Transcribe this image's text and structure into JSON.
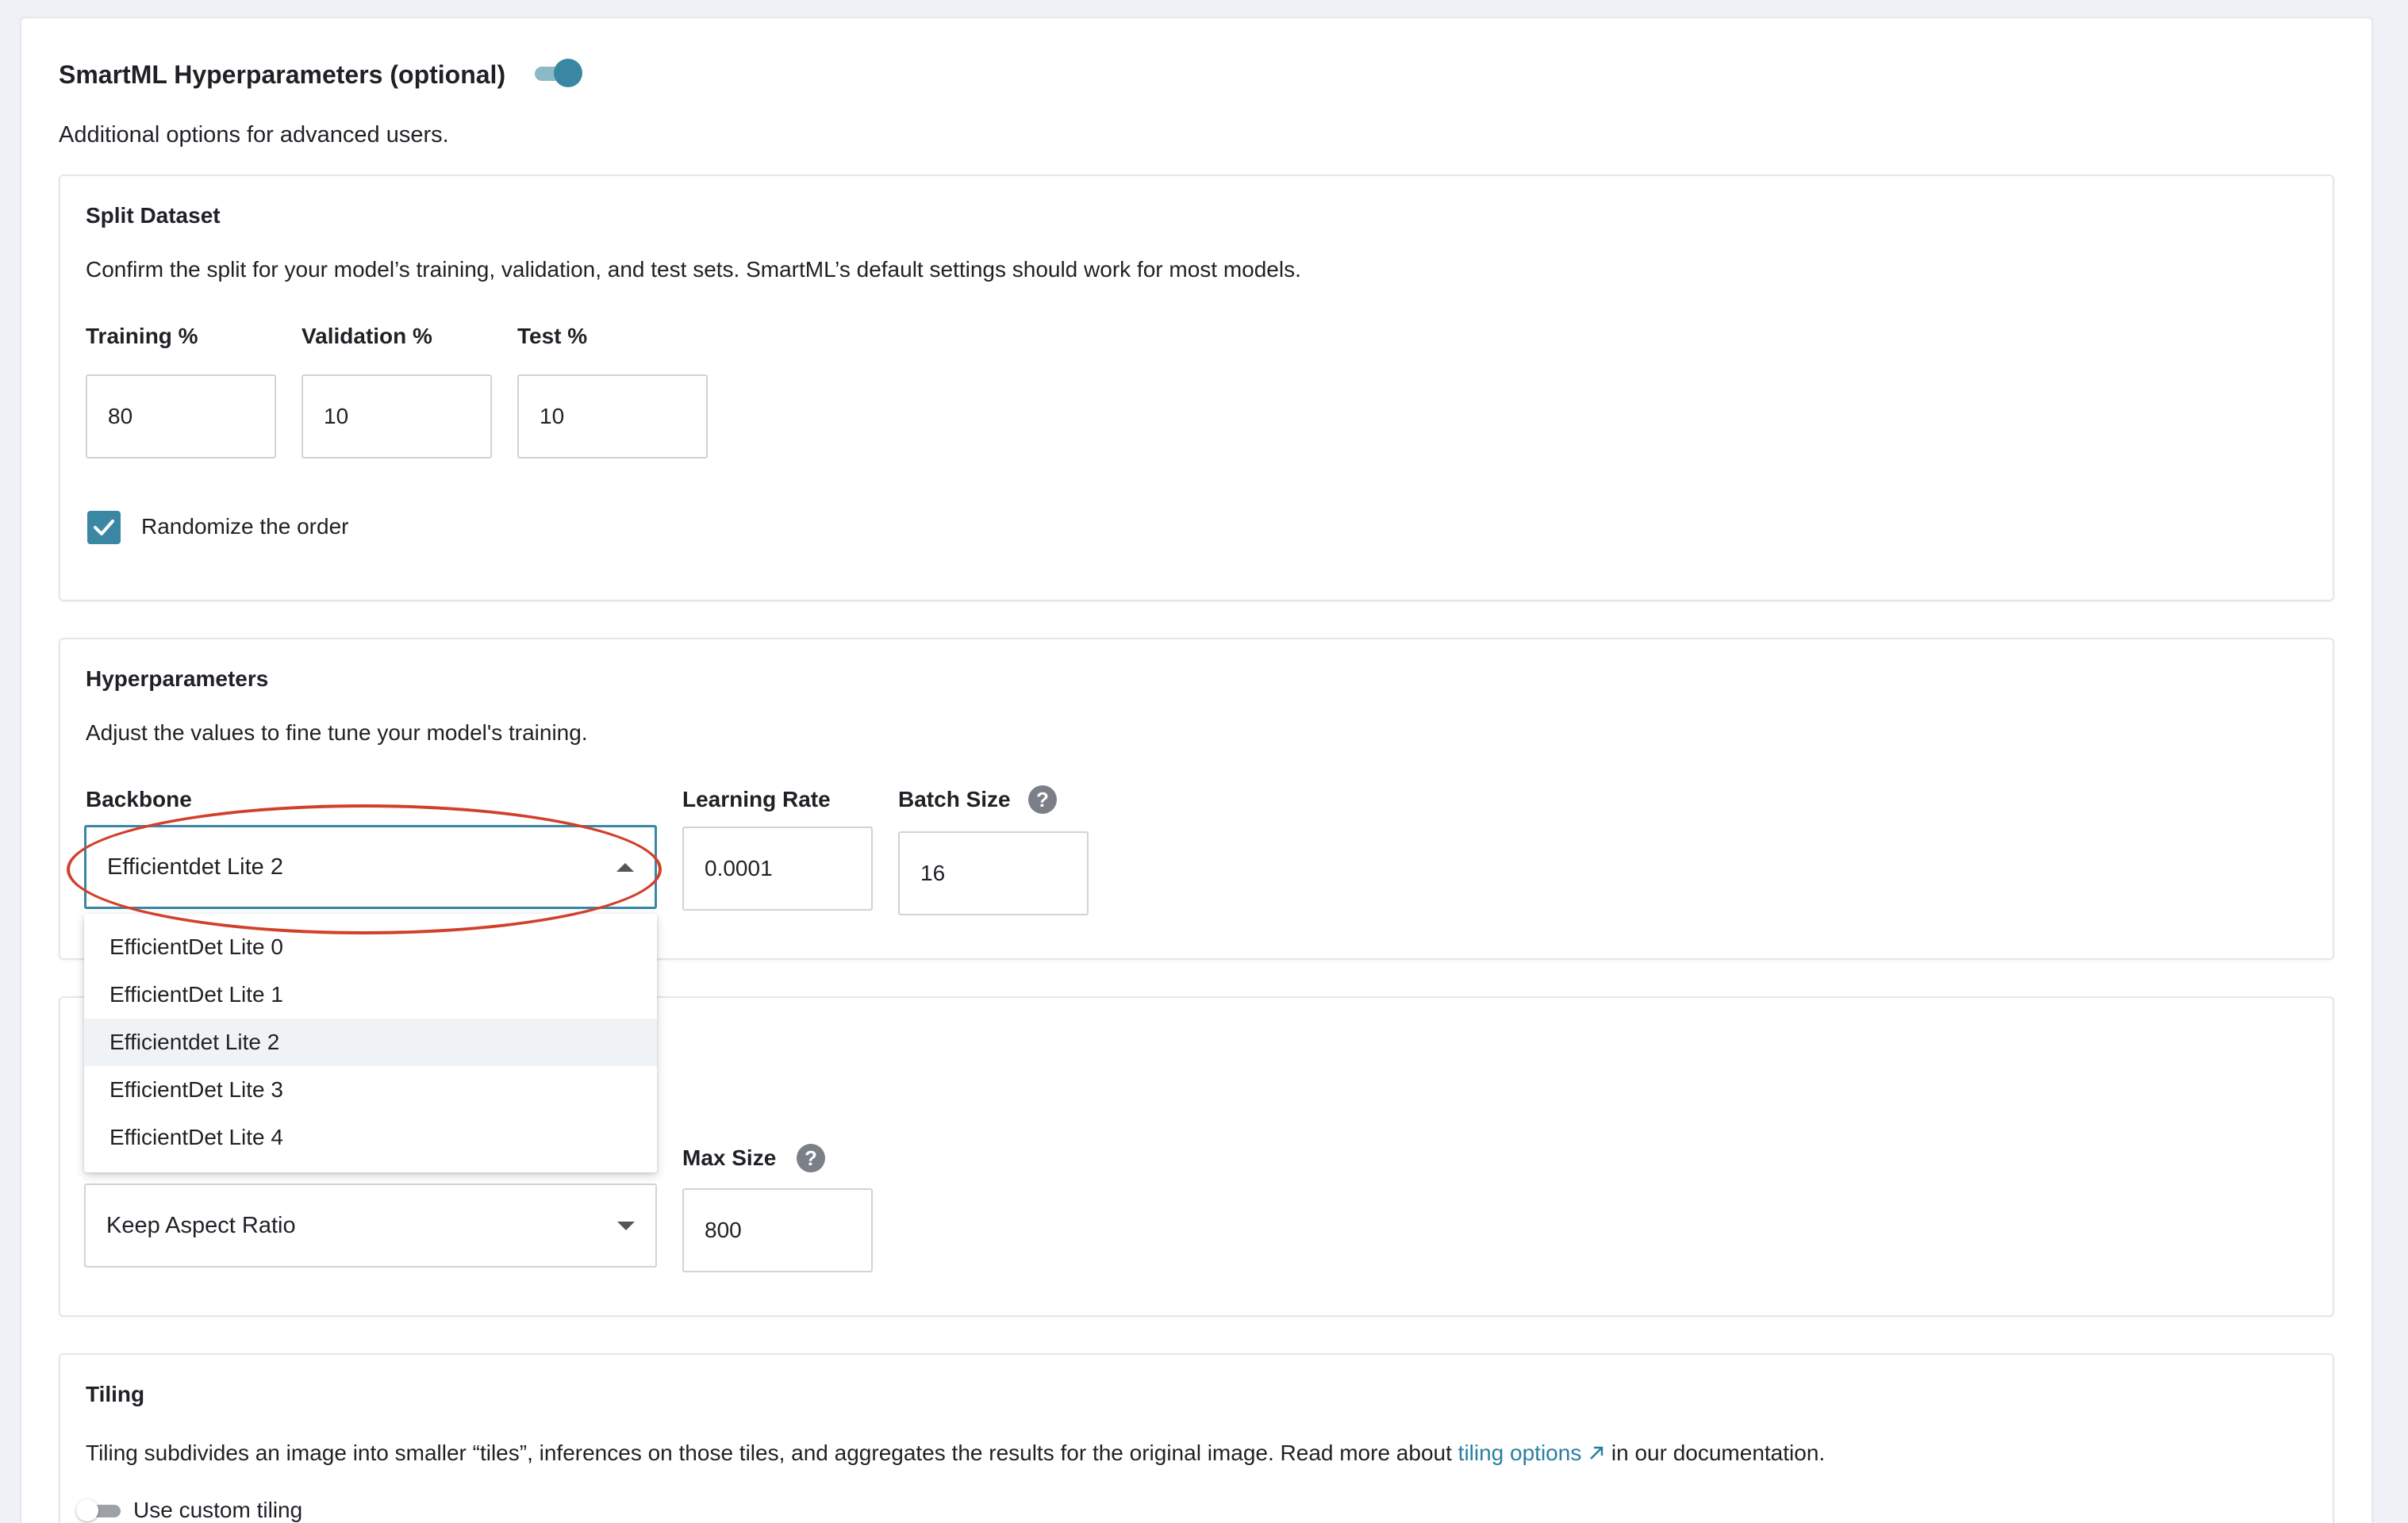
{
  "header": {
    "title": "SmartML Hyperparameters (optional)",
    "toggle_on": true,
    "description": "Additional options for advanced users."
  },
  "split_dataset": {
    "title": "Split Dataset",
    "description": "Confirm the split for your model’s training, validation, and test sets. SmartML’s default settings should work for most models.",
    "training_label": "Training %",
    "training_value": "80",
    "validation_label": "Validation %",
    "validation_value": "10",
    "test_label": "Test %",
    "test_value": "10",
    "randomize_label": "Randomize the order",
    "randomize_checked": true
  },
  "hyperparameters": {
    "title": "Hyperparameters",
    "description": "Adjust the values to fine tune your model's training.",
    "backbone_label": "Backbone",
    "backbone_value": "Efficientdet Lite 2",
    "learning_rate_label": "Learning Rate",
    "learning_rate_value": "0.0001",
    "batch_size_label": "Batch Size",
    "batch_size_value": "16",
    "backbone_options": [
      "EfficientDet Lite 0",
      "EfficientDet Lite 1",
      "Efficientdet Lite 2",
      "EfficientDet Lite 3",
      "EfficientDet Lite 4"
    ],
    "selected_option_index": 2
  },
  "resize": {
    "mode_value": "Keep Aspect Ratio",
    "max_size_label": "Max Size",
    "max_size_value": "800"
  },
  "tiling": {
    "title": "Tiling",
    "description_before": "Tiling subdivides an image into smaller “tiles”, inferences on those tiles, and aggregates the results for the original image. Read more about",
    "link_text": "tiling options",
    "description_after": "in our documentation.",
    "custom_tiling_label": "Use custom tiling",
    "custom_tiling_on": false
  },
  "icons": {
    "help": "question-circle-icon",
    "check": "check-icon",
    "external_link": "external-link-icon",
    "caret_up": "caret-up-icon",
    "caret_down": "caret-down-icon"
  },
  "colors": {
    "accent": "#3a87a3",
    "highlight": "#d1402b",
    "link": "#2a7fa1"
  }
}
